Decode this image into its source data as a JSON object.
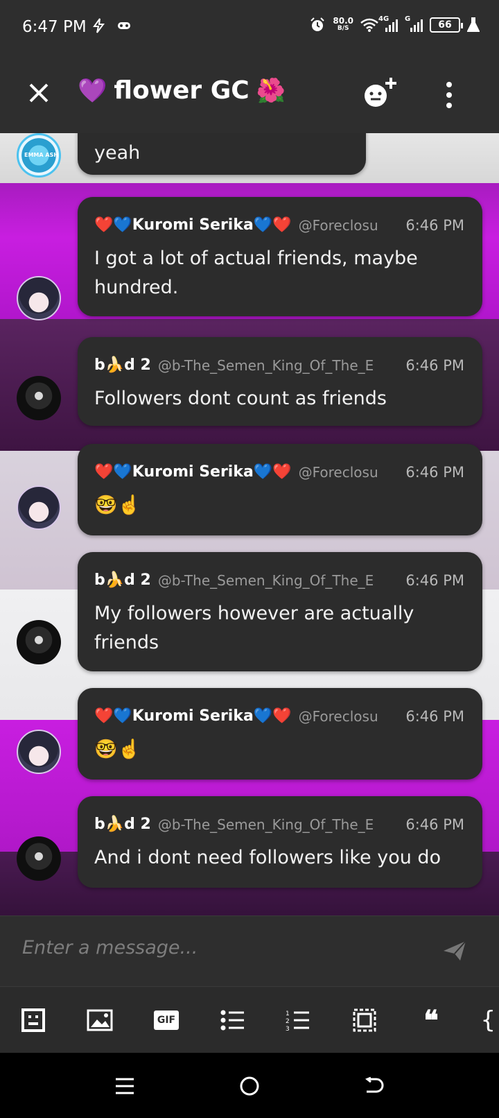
{
  "status_bar": {
    "time": "6:47 PM",
    "net_speed_value": "80.0",
    "net_speed_unit": "B/S",
    "network_type_1": "4G",
    "network_type_2": "G",
    "battery": "66"
  },
  "app_bar": {
    "title": "flower GC",
    "title_prefix_emoji": "💜",
    "title_suffix_emoji": "🌺"
  },
  "messages": [
    {
      "author": "",
      "handle": "",
      "time": "",
      "body": "yeah"
    },
    {
      "author": "❤️💙Kuromi Serika💙❤️",
      "handle": "@Foreclosu",
      "time": "6:46 PM",
      "body": "I got a lot of actual friends, maybe hundred."
    },
    {
      "author": "b🍌d 2",
      "handle": "@b-The_Semen_King_Of_The_E",
      "time": "6:46 PM",
      "body": "Followers dont count as friends"
    },
    {
      "author": "❤️💙Kuromi Serika💙❤️",
      "handle": "@Foreclosu",
      "time": "6:46 PM",
      "body": "🤓☝️"
    },
    {
      "author": "b🍌d 2",
      "handle": "@b-The_Semen_King_Of_The_E",
      "time": "6:46 PM",
      "body": "My followers however are actually friends"
    },
    {
      "author": "❤️💙Kuromi Serika💙❤️",
      "handle": "@Foreclosu",
      "time": "6:46 PM",
      "body": "🤓☝️"
    },
    {
      "author": "b🍌d 2",
      "handle": "@b-The_Semen_King_Of_The_E",
      "time": "6:46 PM",
      "body": "And i dont need followers like you do"
    }
  ],
  "composer": {
    "placeholder": "Enter a message..."
  },
  "toolbar": {
    "items": [
      "sticker-icon",
      "image-icon",
      "gif-icon",
      "bullet-list-icon",
      "numbered-list-icon",
      "spoiler-icon",
      "quote-icon",
      "code-icon"
    ],
    "gif_label": "GIF",
    "quote_glyph": "❝",
    "code_glyph": "{"
  },
  "colors": {
    "bar_bg": "#2e2e2e",
    "bubble_bg": "#2c2c2c",
    "purple_band": "#c018d8",
    "dark_purple_band": "#4a1a55",
    "light_band": "#d8d0dc"
  }
}
